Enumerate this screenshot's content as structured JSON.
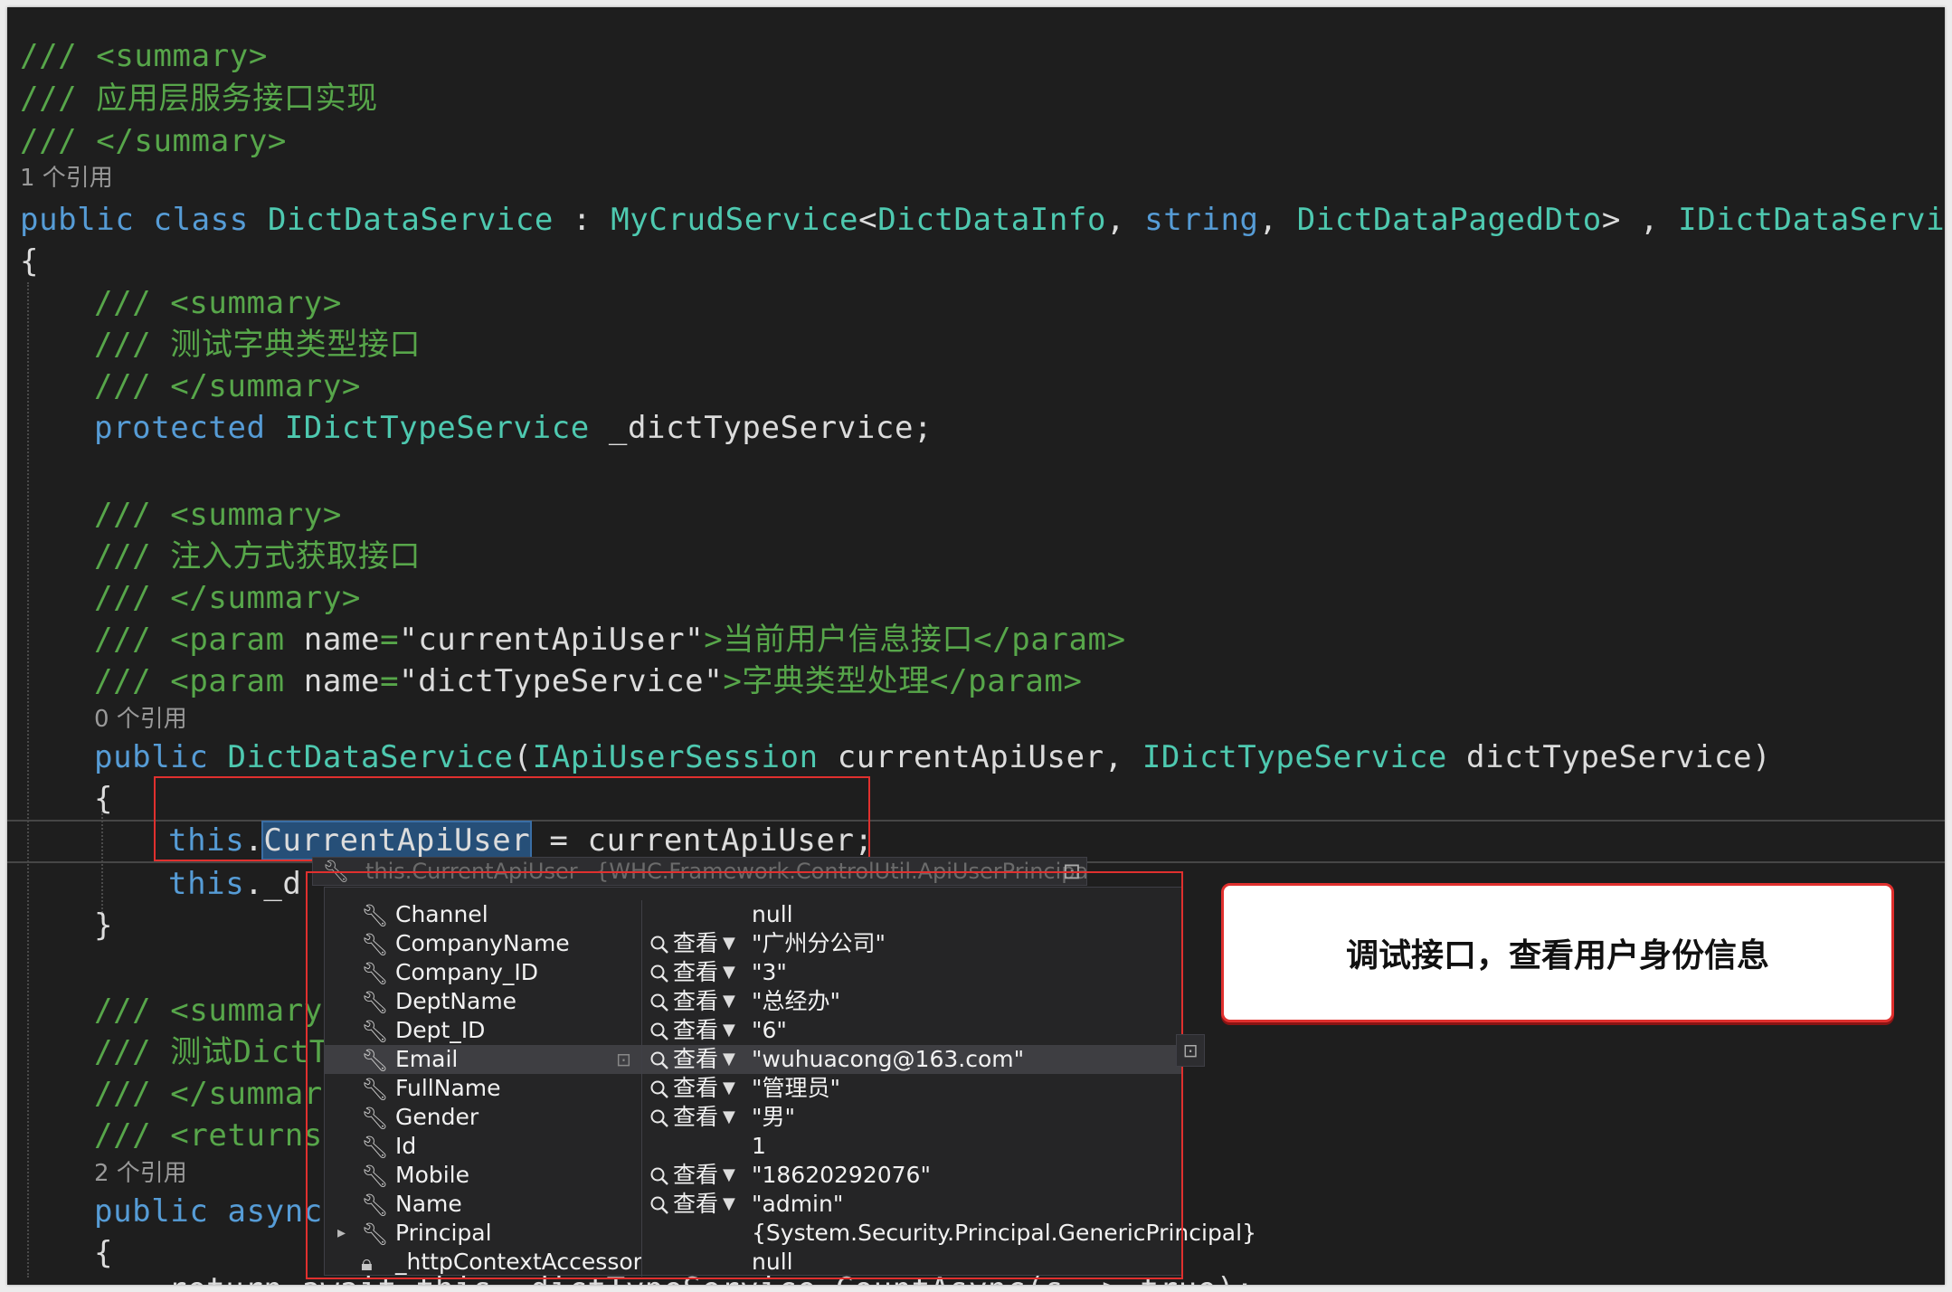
{
  "code": {
    "l1": "/// <summary>",
    "l2": "/// 应用层服务接口实现",
    "l3": "/// </summary>",
    "ref1": "1 个引用",
    "l4_public": "public",
    "l4_class": "class",
    "l4_name": "DictDataService",
    "l4_colon": " : ",
    "l4_base": "MyCrudService",
    "l4_lt": "<",
    "l4_t1": "DictDataInfo",
    "l4_comma1": ", ",
    "l4_t2": "string",
    "l4_comma2": ", ",
    "l4_t3": "DictDataPagedDto",
    "l4_gt": "> , ",
    "l4_iface": "IDictDataService",
    "brace_open": "{",
    "brace_close": "}",
    "l6": "/// <summary>",
    "l7": "/// 测试字典类型接口",
    "l8": "/// </summary>",
    "l9_kw": "protected",
    "l9_type": "IDictTypeService",
    "l9_field": " _dictTypeService;",
    "l10": "/// <summary>",
    "l11": "/// 注入方式获取接口",
    "l12": "/// </summary>",
    "l13_pre": "/// <param ",
    "l13_attr": "name",
    "l13_eq": "=",
    "l13_q": "\"currentApiUser\"",
    "l13_post": ">当前用户信息接口</param>",
    "l14_pre": "/// <param ",
    "l14_attr": "name",
    "l14_eq": "=",
    "l14_q": "\"dictTypeService\"",
    "l14_post": ">字典类型处理</param>",
    "ref0": "0 个引用",
    "l15_public": "public",
    "l15_name": "DictDataService",
    "l15_paren": "(",
    "l15_p1t": "IApiUserSession",
    "l15_p1n": " currentApiUser, ",
    "l15_p2t": "IDictTypeService",
    "l15_p2n": " dictTypeService)",
    "l17_this": "this",
    "l17_dot": ".",
    "l17_prop": "CurrentApiUser",
    "l17_rest": " = currentApiUser;",
    "l18_this": "this",
    "l18_rest": "._d",
    "l20": "/// <summary>",
    "l21": "/// 测试DictT",
    "l22": "/// </summary",
    "l23": "/// <returns>",
    "ref2": "2 个引用",
    "l24_public": "public",
    "l24_async": "async",
    "l26": "return await this._dictTypeService.CountAsync(s => true);"
  },
  "tooltip": {
    "expression": "this.CurrentApiUser",
    "type": "{WHC.Framework.ControlUtil.ApiUserPrincipal}",
    "pin": "⊡"
  },
  "watch": {
    "view_label": "查看",
    "rows": [
      {
        "name": "Channel",
        "value": "null",
        "viewer": false,
        "icon": "wrench-icon"
      },
      {
        "name": "CompanyName",
        "value": "\"广州分公司\"",
        "viewer": true,
        "icon": "wrench-icon"
      },
      {
        "name": "Company_ID",
        "value": "\"3\"",
        "viewer": true,
        "icon": "wrench-icon"
      },
      {
        "name": "DeptName",
        "value": "\"总经办\"",
        "viewer": true,
        "icon": "wrench-icon"
      },
      {
        "name": "Dept_ID",
        "value": "\"6\"",
        "viewer": true,
        "icon": "wrench-icon"
      },
      {
        "name": "Email",
        "value": "\"wuhuacong@163.com\"",
        "viewer": true,
        "icon": "wrench-icon"
      },
      {
        "name": "FullName",
        "value": "\"管理员\"",
        "viewer": true,
        "icon": "wrench-icon"
      },
      {
        "name": "Gender",
        "value": "\"男\"",
        "viewer": true,
        "icon": "wrench-icon"
      },
      {
        "name": "Id",
        "value": "1",
        "viewer": false,
        "icon": "wrench-icon"
      },
      {
        "name": "Mobile",
        "value": "\"18620292076\"",
        "viewer": true,
        "icon": "wrench-icon"
      },
      {
        "name": "Name",
        "value": "\"admin\"",
        "viewer": true,
        "icon": "wrench-icon"
      },
      {
        "name": "Principal",
        "value": "{System.Security.Principal.GenericPrincipal}",
        "viewer": false,
        "icon": "wrench-gear-icon"
      },
      {
        "name": "_httpContextAccessor",
        "value": "null",
        "viewer": false,
        "icon": "private-field-icon"
      }
    ]
  },
  "callout": {
    "text": "调试接口，查看用户身份信息"
  },
  "colors": {
    "annotation_red": "#e0302e",
    "comment": "#57a64a",
    "keyword": "#569cd6",
    "type": "#4ec9b0"
  }
}
